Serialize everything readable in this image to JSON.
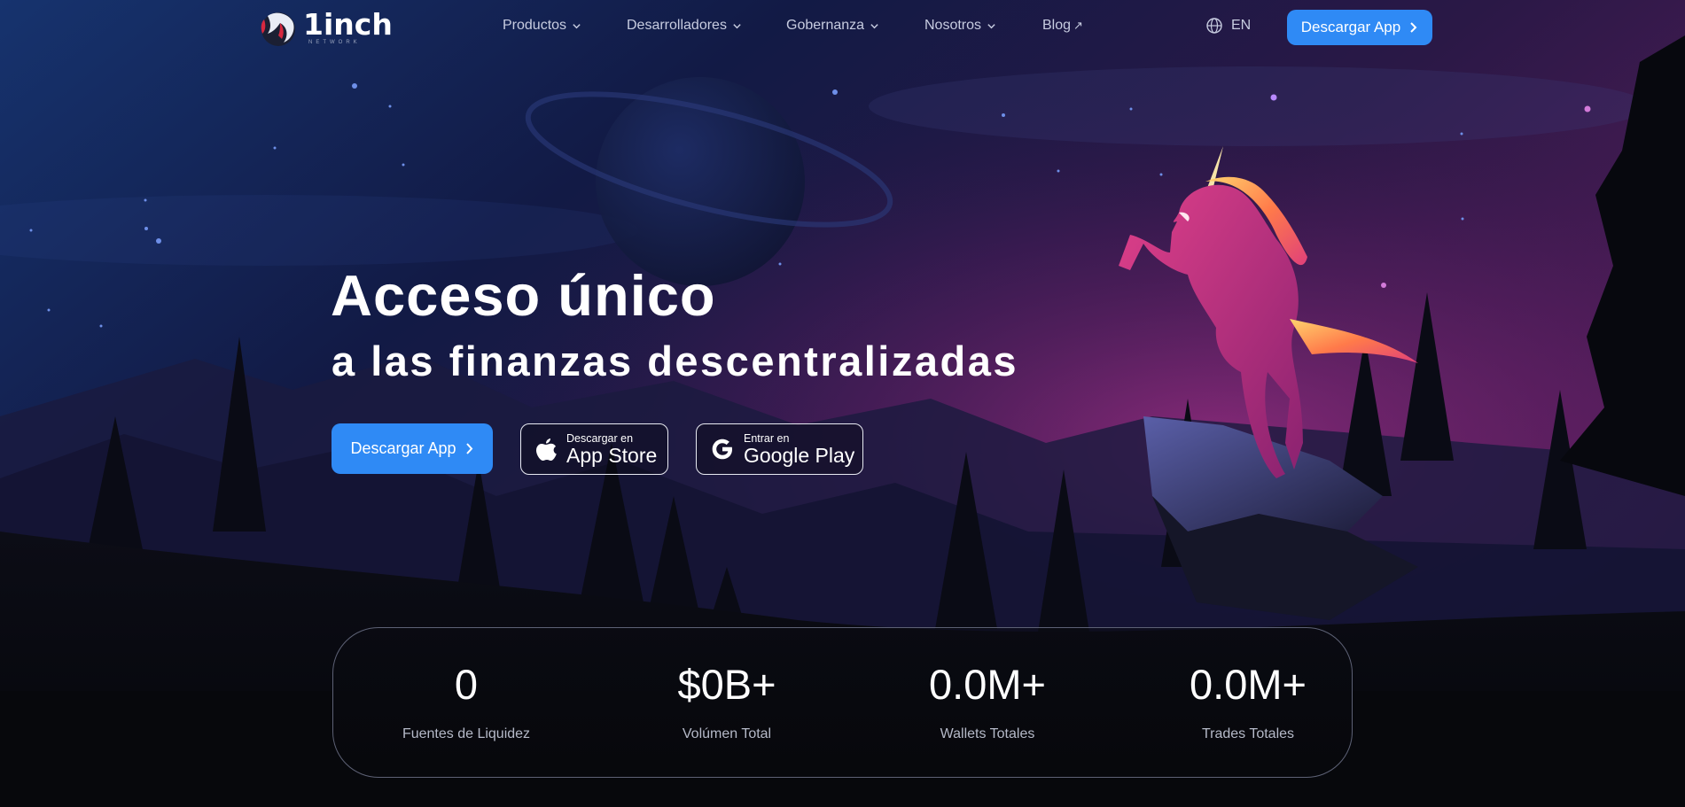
{
  "nav": {
    "logo_text": "1inch",
    "logo_subtext": "NETWORK",
    "menu": [
      {
        "label": "Productos",
        "icon": "chevron-down-icon"
      },
      {
        "label": "Desarrolladores",
        "icon": "chevron-down-icon"
      },
      {
        "label": "Gobernanza",
        "icon": "chevron-down-icon"
      },
      {
        "label": "Nosotros",
        "icon": "chevron-down-icon"
      },
      {
        "label": "Blog",
        "icon": "external-arrow-icon"
      }
    ],
    "language": "EN",
    "download_label": "Descargar App"
  },
  "hero": {
    "title": "Acceso único",
    "subtitle": "a las finanzas descentralizadas",
    "download_label": "Descargar App",
    "app_store": {
      "small": "Descargar en",
      "big": "App Store"
    },
    "google_play": {
      "small": "Entrar en",
      "big": "Google Play"
    }
  },
  "stats": [
    {
      "value": "0",
      "label": "Fuentes de Liquidez"
    },
    {
      "value": "$0B+",
      "label": "Volúmen Total"
    },
    {
      "value": "0.0M+",
      "label": "Wallets Totales"
    },
    {
      "value": "0.0M+",
      "label": "Trades Totales"
    }
  ],
  "colors": {
    "accent": "#2f8af5",
    "background": "#07080c",
    "sky_top": "#11224a",
    "sky_magenta": "#7a2870"
  }
}
